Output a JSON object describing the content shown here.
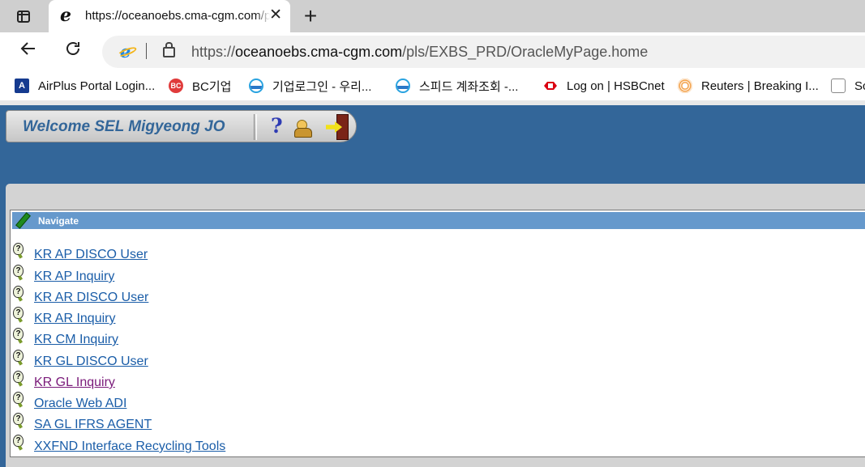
{
  "browser": {
    "tab": {
      "title": "https://oceanoebs.cma-cgm.com/pls/EXBS_PRD/OracleMyPage.home"
    },
    "address": {
      "protocol": "https://",
      "host": "oceanoebs.cma-cgm.com",
      "path": "/pls/EXBS_PRD/OracleMyPage.home"
    },
    "bookmarks": [
      {
        "label": "AirPlus Portal Login...",
        "icon": "airplus-icon"
      },
      {
        "label": "BC기업",
        "icon": "bc-card-icon"
      },
      {
        "label": "기업로그인 - 우리...",
        "icon": "woori-bank-icon"
      },
      {
        "label": "스피드 계좌조회 -...",
        "icon": "woori-bank-icon"
      },
      {
        "label": "Log on | HSBCnet",
        "icon": "hsbc-icon"
      },
      {
        "label": "Reuters | Breaking I...",
        "icon": "reuters-icon"
      },
      {
        "label": "Sc",
        "icon": "bookmark-icon"
      }
    ]
  },
  "page": {
    "welcome": "Welcome SEL Migyeong JO",
    "help_glyph": "?",
    "navigate": {
      "title": "Navigate",
      "links": [
        {
          "label": "KR AP DISCO User",
          "visited": false
        },
        {
          "label": "KR AP Inquiry",
          "visited": false
        },
        {
          "label": "KR AR DISCO User",
          "visited": false
        },
        {
          "label": "KR AR Inquiry",
          "visited": false
        },
        {
          "label": "KR CM Inquiry",
          "visited": false
        },
        {
          "label": "KR GL DISCO User",
          "visited": false
        },
        {
          "label": "KR GL Inquiry",
          "visited": true
        },
        {
          "label": "Oracle Web ADI",
          "visited": false
        },
        {
          "label": "SA GL IFRS AGENT",
          "visited": false
        },
        {
          "label": "XXFND Interface Recycling Tools",
          "visited": false
        }
      ]
    }
  },
  "colors": {
    "page_background": "#336699",
    "header_bar": "#6699cc",
    "link": "#1a5da8",
    "visited_link": "#7a1a7a"
  }
}
